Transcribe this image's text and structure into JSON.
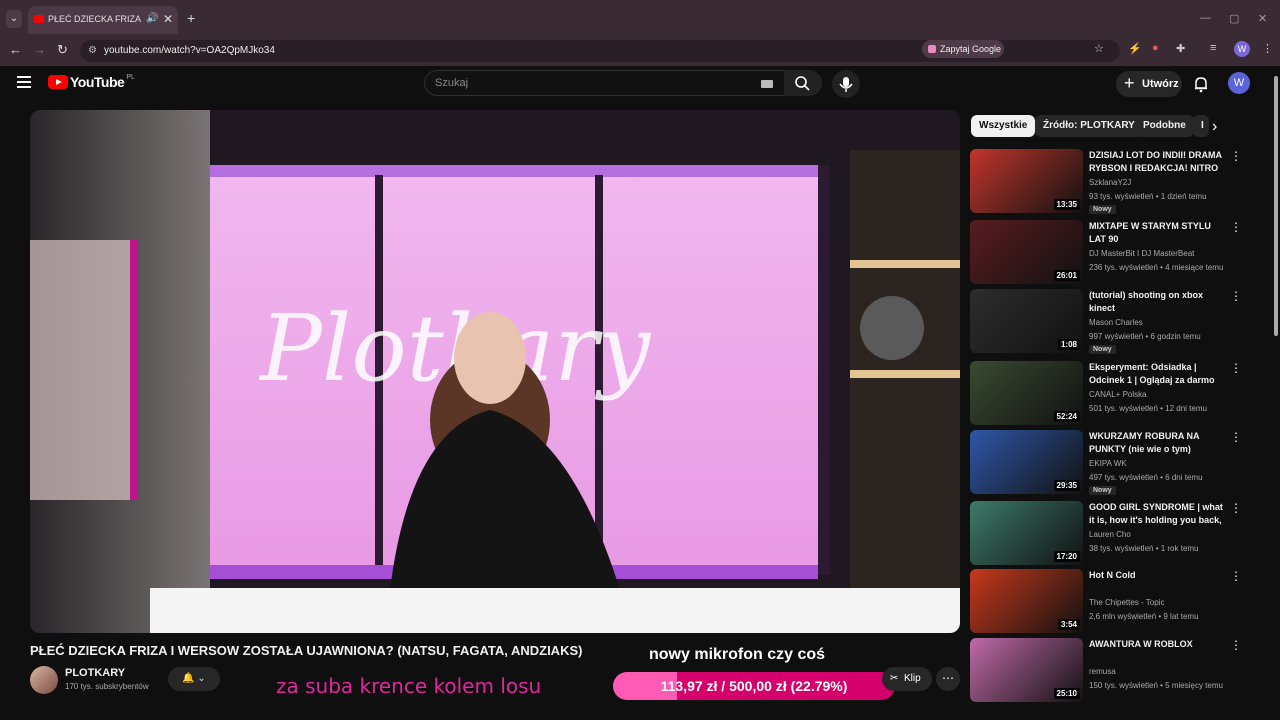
{
  "browser": {
    "tab_title": "PŁEĆ DZIECKA FRIZA I WER",
    "url": "youtube.com/watch?v=OA2QpMJko34",
    "ask_google": "Zapytaj Google",
    "profile_initial": "W"
  },
  "header": {
    "logo_text": "YouTube",
    "country": "PL",
    "search_placeholder": "Szukaj",
    "create_label": "Utwórz",
    "avatar_initial": "W"
  },
  "video": {
    "title": "PŁEĆ DZIECKA FRIZA I WERSOW ZOSTAŁA UJAWNIONA? (NATSU, FAGATA, ANDZIAKS)",
    "channel": "PLOTKARY",
    "subscribers": "170 tys. subskrybentów",
    "clip_label": "Klip"
  },
  "overlay": {
    "text_left": "za suba krence kolem losu",
    "text_top": "nowy mikrofon czy coś",
    "donation_label": "113,97 zł / 500,00 zł (22.79%)",
    "donation_progress": 0.2279
  },
  "chips": [
    "Wszystkie",
    "Źródło: PLOTKARY",
    "Podobne",
    "I"
  ],
  "recommendations": [
    {
      "title": "DZISIAJ LOT DO INDII! DRAMA RYBSON I REDAKCJA! NITRO ...",
      "channel": "SzklanaY2J",
      "meta": "93 tys. wyświetleń • 1 dzień temu",
      "badge": "Nowy",
      "duration": "13:35",
      "color": "#c2352c"
    },
    {
      "title": "MIXTAPE W STARYM STYLU LAT 90",
      "channel": "DJ MasterBit I DJ MasterBeat",
      "meta": "236 tys. wyświetleń • 4 miesiące temu",
      "badge": "",
      "duration": "26:01",
      "color": "#5a1c20"
    },
    {
      "title": "(tutorial) shooting on xbox kinect",
      "channel": "Mason Charles",
      "meta": "997 wyświetleń • 6 godzin temu",
      "badge": "Nowy",
      "duration": "1:08",
      "color": "#2d2d2d"
    },
    {
      "title": "Eksperyment: Odsiadka | Odcinek 1 | Oglądaj za darmo",
      "channel": "CANAL+ Polska",
      "meta": "501 tys. wyświetleń • 12 dni temu",
      "badge": "",
      "duration": "52:24",
      "color": "#3a4a32"
    },
    {
      "title": "WKURZAMY ROBURA NA PUNKTY (nie wie o tym)",
      "channel": "EKIPA WK",
      "meta": "497 tys. wyświetleń • 6 dni temu",
      "badge": "Nowy",
      "duration": "29:35",
      "color": "#2f57a8"
    },
    {
      "title": "GOOD GIRL SYNDROME | what it is, how it's holding you back, ...",
      "channel": "Lauren Cho",
      "meta": "38 tys. wyświetleń • 1 rok temu",
      "badge": "",
      "duration": "17:20",
      "color": "#3d7a6a"
    },
    {
      "title": "Hot N Cold",
      "channel": "The Chipettes - Topic",
      "meta": "2,6 mln wyświetleń • 9 lat temu",
      "badge": "",
      "duration": "3:54",
      "color": "#c7391c"
    },
    {
      "title": "AWANTURA W ROBLOX",
      "channel": "remusa",
      "meta": "150 tys. wyświetleń • 5 miesięcy temu",
      "badge": "",
      "duration": "25:10",
      "color": "#c06aa8"
    }
  ]
}
